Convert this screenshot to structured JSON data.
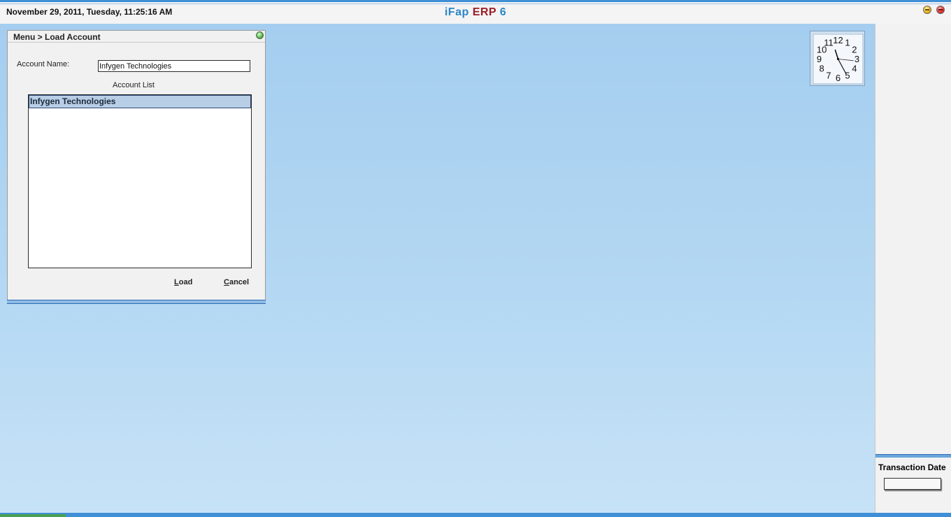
{
  "header": {
    "datetime": "November  29, 2011, Tuesday, 11:25:16 AM",
    "app_title_part1": "iFap",
    "app_title_part2": "ERP",
    "app_title_part3": "6"
  },
  "clock": {
    "numerals": [
      "12",
      "1",
      "2",
      "3",
      "4",
      "5",
      "6",
      "7",
      "8",
      "9",
      "10",
      "11"
    ],
    "time": "11:25:16"
  },
  "dialog": {
    "title": "Menu > Load Account",
    "account_name_label": "Account Name:",
    "account_name_value": "Infygen Technologies",
    "account_list_label": "Account List",
    "account_list": [
      "Infygen Technologies"
    ],
    "load_label_accel": "L",
    "load_label_rest": "oad",
    "cancel_label_accel": "C",
    "cancel_label_rest": "ancel"
  },
  "right_panel": {
    "transaction_date_label": "Transaction Date",
    "transaction_date_value": ""
  },
  "colors": {
    "accent_blue": "#3f8fd6",
    "title_blue": "#2a86c8",
    "title_red": "#9b1c26",
    "desktop_top": "#a4cdef",
    "desktop_bottom": "#c7e2f6"
  }
}
